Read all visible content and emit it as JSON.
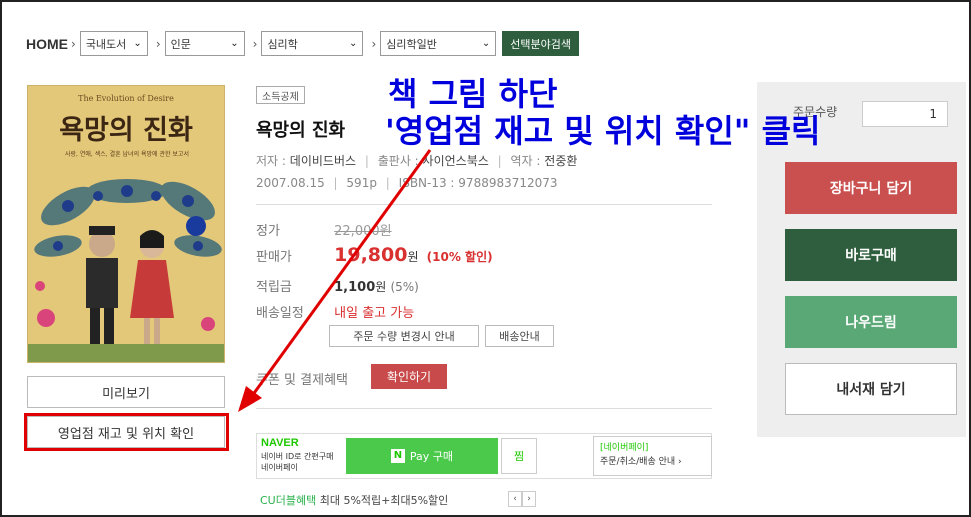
{
  "breadcrumb": {
    "home": "HOME",
    "selects": [
      "국내도서",
      "인문",
      "심리학",
      "심리학일반"
    ],
    "search_button": "선택분야검색"
  },
  "cover": {
    "subtitle": "The Evolution of Desire",
    "title": "욕망의 진화",
    "tagline": "사랑, 연애, 섹스, 결혼 남녀의 욕망에 관한 보고서"
  },
  "left_buttons": {
    "preview": "미리보기",
    "stock": "영업점 재고 및 위치 확인"
  },
  "book": {
    "badge": "소득공제",
    "title": "욕망의 진화",
    "author_label": "저자 :",
    "author": "데이비드버스",
    "publisher_label": "출판사 :",
    "publisher": "사이언스북스",
    "translator_label": "역자 :",
    "translator": "전중환",
    "date": "2007.08.15",
    "pages": "591p",
    "isbn": "ISBN-13 : 9788983712073"
  },
  "price": {
    "list_label": "정가",
    "list_value": "22,000원",
    "sale_label": "판매가",
    "sale_value": "19,800",
    "sale_unit": "원",
    "discount": "(10% 할인)",
    "points_label": "적립금",
    "points_value": "1,100",
    "points_unit": "원",
    "points_rate": "(5%)",
    "ship_label": "배송일정",
    "ship_value": "내일 출고 가능",
    "chip_qty": "주문 수량 변경시 안내",
    "chip_ship": "배송안내",
    "coupon_label": "쿠폰 및 결제혜택",
    "coupon_button": "확인하기"
  },
  "naver": {
    "logo": "NAVER",
    "line1": "네이버 ID로 간편구매",
    "line2": "네이버페이",
    "pay_icon": "N",
    "pay_label": "Pay 구매",
    "zzim": "찜",
    "link_title": "[네이버페이]",
    "link_text": "주문/취소/배송 안내 ›"
  },
  "cu": {
    "label": "CU더블혜택",
    "text": "최대 5%적립+최대5%할인",
    "prev": "‹",
    "next": "›"
  },
  "panel": {
    "qty_label": "주문수량",
    "qty_value": "1",
    "cart": "장바구니 담기",
    "buy": "바로구매",
    "download": "나우드림",
    "shelf": "내서재 담기"
  },
  "annotation": {
    "line1": "책 그림 하단",
    "line2": "'영업점 재고 및 위치 확인\" 클릭"
  },
  "colors": {
    "accent_green": "#2e5e3e",
    "price_red": "#d93030",
    "annotation_blue": "#0000dd",
    "highlight_red": "#e00000"
  }
}
